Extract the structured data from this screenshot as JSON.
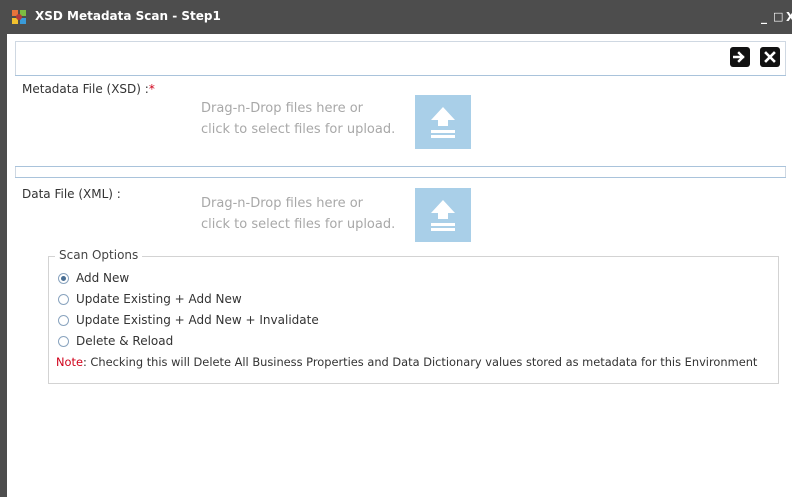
{
  "window": {
    "title": "XSD Metadata Scan - Step1",
    "controls": {
      "minimize": "_",
      "maximize": "□",
      "close": "X"
    }
  },
  "toolbar": {
    "next_icon": "arrow-right-icon",
    "close_icon": "close-icon"
  },
  "metadata_file": {
    "label": "Metadata File (XSD) :",
    "required_mark": "*",
    "drop_line1": "Drag-n-Drop files here or",
    "drop_line2": "click to select files for upload.",
    "upload_icon": "upload-icon"
  },
  "data_file": {
    "label": "Data File (XML) :",
    "drop_line1": "Drag-n-Drop files here or",
    "drop_line2": "click to select files for upload.",
    "upload_icon": "upload-icon"
  },
  "scan_options": {
    "legend": "Scan Options",
    "options": [
      {
        "label": "Add New",
        "selected": true
      },
      {
        "label": "Update Existing + Add New",
        "selected": false
      },
      {
        "label": "Update Existing + Add New + Invalidate",
        "selected": false
      },
      {
        "label": "Delete & Reload",
        "selected": false
      }
    ],
    "note_key": "Note",
    "note_text": ": Checking this will Delete All Business Properties and Data Dictionary values stored as metadata for this Environment"
  },
  "colors": {
    "titlebar": "#4d4d4d",
    "upload_button": "#a9cfe8",
    "required": "#d0021b",
    "section_border": "#a9c3db"
  }
}
